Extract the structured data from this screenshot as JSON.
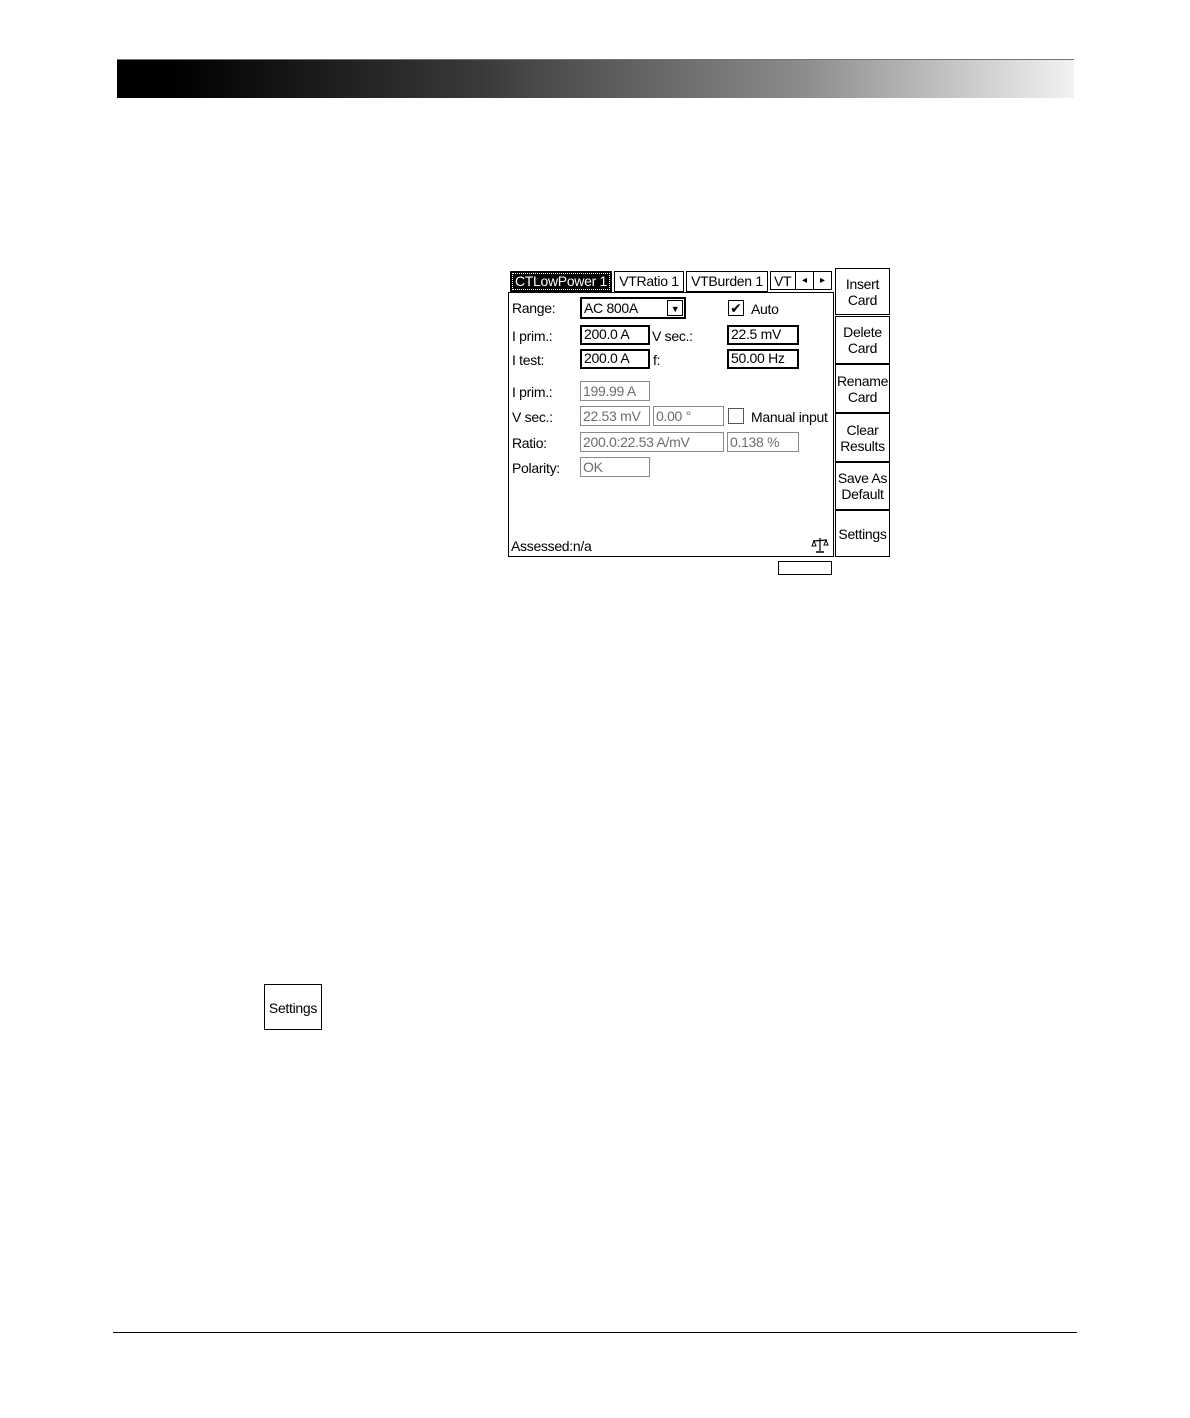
{
  "tabs": [
    {
      "label": "CTLowPower 1",
      "active": true
    },
    {
      "label": "VTRatio 1",
      "active": false
    },
    {
      "label": "VTBurden 1",
      "active": false
    },
    {
      "label": "VT",
      "active": false
    }
  ],
  "tab_nav": {
    "left_icon": "◂",
    "right_icon": "▸"
  },
  "form": {
    "range_label": "Range:",
    "range_value": "AC 800A",
    "range_dropdown_icon": "▼",
    "auto_label": "Auto",
    "auto_checked": true,
    "check_mark": "✔",
    "iprim_label": "I prim.:",
    "iprim_value": "200.0 A",
    "vsec_label": "V sec.:",
    "vsec_value": "22.5 mV",
    "itest_label": "I test:",
    "itest_value": "200.0 A",
    "f_label": "f:",
    "f_value": "50.00 Hz"
  },
  "results": {
    "iprim_label": "I prim.:",
    "iprim_value": "199.99 A",
    "vsec_label": "V sec.:",
    "vsec_value": "22.53 mV",
    "vsec_phase": "0.00 °",
    "manual_input_label": "Manual input",
    "manual_input_checked": false,
    "ratio_label": "Ratio:",
    "ratio_value": "200.0:22.53 A/mV",
    "ratio_error": "0.138 %",
    "polarity_label": "Polarity:",
    "polarity_value": "OK"
  },
  "status": {
    "assessed": "Assessed:n/a"
  },
  "side_buttons": [
    {
      "line1": "Insert",
      "line2": "Card"
    },
    {
      "line1": "Delete",
      "line2": "Card"
    },
    {
      "line1": "Rename",
      "line2": "Card"
    },
    {
      "line1": "Clear",
      "line2": "Results"
    },
    {
      "line1": "Save As",
      "line2": "Default"
    },
    {
      "line1": "Settings",
      "line2": ""
    }
  ],
  "standalone_button": {
    "label": "Settings"
  },
  "colors": {
    "header_dark": "#000000",
    "header_light": "#f2f2f2",
    "readonly_border": "#8a8a8a",
    "readonly_text": "#6d6d6d"
  }
}
